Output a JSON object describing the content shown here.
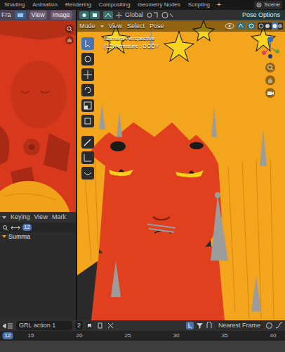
{
  "topbar": {
    "tabs": [
      {
        "label": "Shading",
        "selected": false
      },
      {
        "label": "Animation",
        "selected": false
      },
      {
        "label": "Rendering",
        "selected": false
      },
      {
        "label": "Compositing",
        "selected": false
      },
      {
        "label": "Geometry Nodes",
        "selected": false
      },
      {
        "label": "Scripting",
        "selected": false
      }
    ],
    "add": "+",
    "scene": "Scene"
  },
  "image_editor": {
    "label": "Fra",
    "menus": [
      "View",
      "Image"
    ]
  },
  "viewport": {
    "orientation": "Global",
    "pose_options": "Pose Options",
    "menus": [
      "Mode",
      "View",
      "Select",
      "Pose"
    ],
    "overlay": {
      "view": "Camera Perspective",
      "object": "(12) Armature : BODY"
    }
  },
  "dope_sheet": {
    "menus": [
      "Keying",
      "View",
      "Mark"
    ],
    "frame": "12",
    "summary": "Summa"
  },
  "action_bar": {
    "action": "GRL action 1",
    "users": "2",
    "snap": "Nearest Frame"
  },
  "timeline": {
    "ticks": [
      {
        "label": "12",
        "current": true
      },
      {
        "label": "15",
        "current": false
      },
      {
        "label": "20",
        "current": false
      },
      {
        "label": "25",
        "current": false
      },
      {
        "label": "30",
        "current": false
      },
      {
        "label": "35",
        "current": false
      },
      {
        "label": "40",
        "current": false
      }
    ]
  }
}
